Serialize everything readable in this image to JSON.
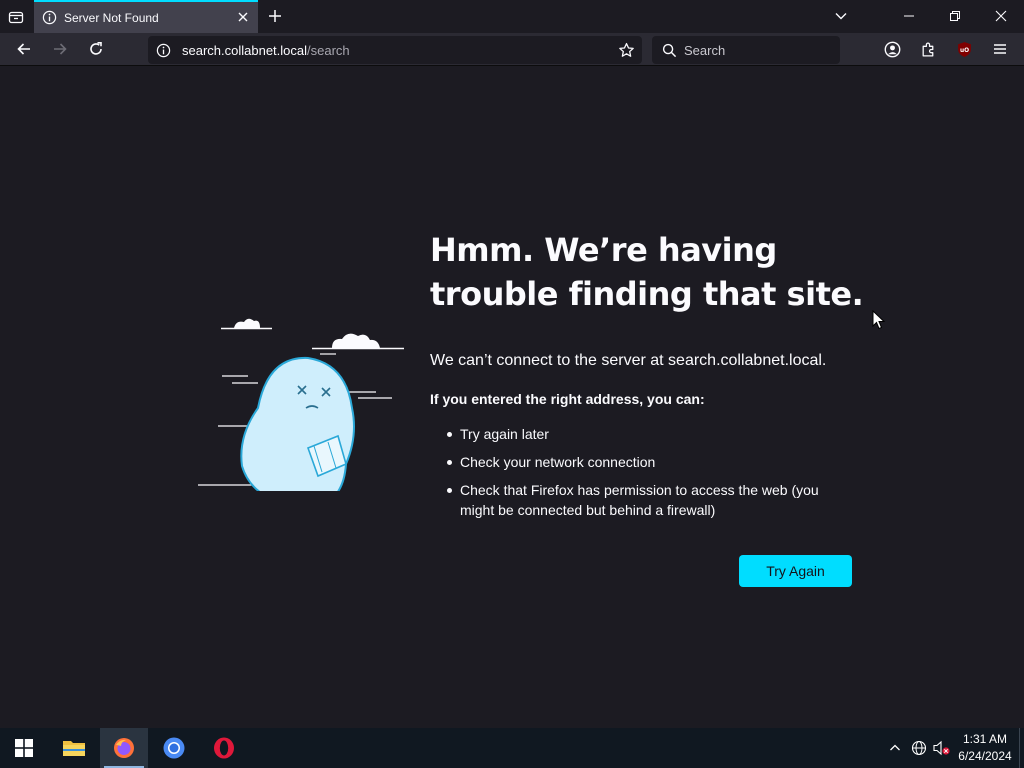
{
  "browser": {
    "tab": {
      "title": "Server Not Found"
    },
    "url": {
      "host": "search.collabnet.local",
      "path": "/search"
    },
    "search": {
      "placeholder": "Search"
    }
  },
  "error_page": {
    "title": "Hmm. We’re having trouble finding that site.",
    "description": "We can’t connect to the server at search.collabnet.local.",
    "subheading": "If you entered the right address, you can:",
    "suggestions": [
      "Try again later",
      "Check your network connection",
      "Check that Firefox has permission to access the web (you might be connected but behind a firewall)"
    ],
    "try_again_label": "Try Again"
  },
  "taskbar": {
    "apps": [
      "file-explorer-icon",
      "firefox-icon",
      "chromium-icon",
      "opera-icon"
    ],
    "time": "1:31 AM",
    "date": "6/24/2024"
  },
  "colors": {
    "accent": "#00ddff",
    "background": "#1c1b22",
    "toolbar": "#2b2a33"
  }
}
